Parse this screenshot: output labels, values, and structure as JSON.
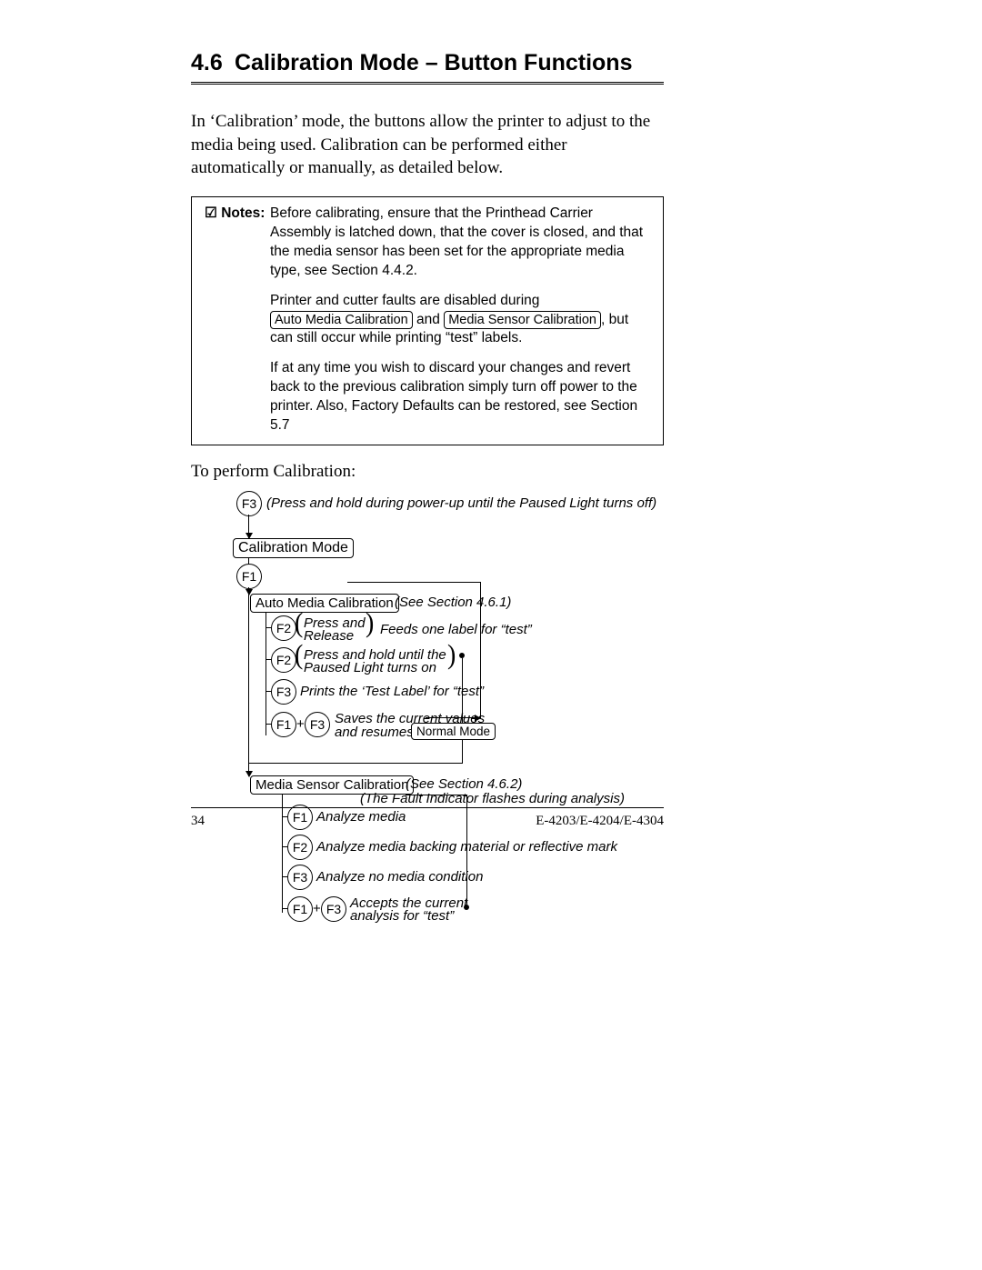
{
  "heading": {
    "number": "4.6",
    "title": "Calibration Mode – Button Functions"
  },
  "intro": "In ‘Calibration’ mode, the buttons allow the printer to adjust to the media being used. Calibration can be performed either automatically or manually, as detailed below.",
  "notes": {
    "label": "☑ Notes:",
    "p1": "Before calibrating, ensure that the Printhead Carrier Assembly is latched down, that the cover is closed, and that the media sensor has been set for the appropriate media type, see Section 4.4.2.",
    "p2a": "Printer and cutter faults are disabled during ",
    "p2box1": "Auto Media Calibration",
    "p2b": " and ",
    "p2box2": "Media Sensor Calibration",
    "p2c": ", but can still occur while printing “test” labels.",
    "p3": "If at any time you wish to discard your changes and revert back to the previous calibration simply turn off power to the printer. Also, Factory Defaults can be restored, see Section 5.7"
  },
  "lead": "To perform Calibration:",
  "flow": {
    "f3_top_note": "(Press and hold during power-up until the Paused Light turns off)",
    "mode_box": "Calibration Mode",
    "f1": "F1",
    "f2": "F2",
    "f3": "F3",
    "auto_box": "Auto Media Calibration",
    "auto_ref": "(See Section 4.6.1)",
    "f2_pr_a": "Press and",
    "f2_pr_b": "Release",
    "f2_pr_note": "Feeds one label for “test”",
    "f2_hold_a": "Press and hold until the",
    "f2_hold_b": "Paused Light turns on",
    "f3_print": "Prints the ‘Test Label’ for “test”",
    "save_a": "Saves the current values",
    "save_b": "and resumes",
    "normal_box": "Normal Mode",
    "msc_box": "Media Sensor Calibration",
    "msc_ref": "(See Section 4.6.2)",
    "msc_note": "(The Fault Indicator flashes during analysis)",
    "a1": "Analyze media",
    "a2": "Analyze media backing material or reflective mark",
    "a3": "Analyze no media condition",
    "accept_a": "Accepts the current",
    "accept_b": "analysis for “test”"
  },
  "footer": {
    "page": "34",
    "doc": "E-4203/E-4204/E-4304"
  }
}
